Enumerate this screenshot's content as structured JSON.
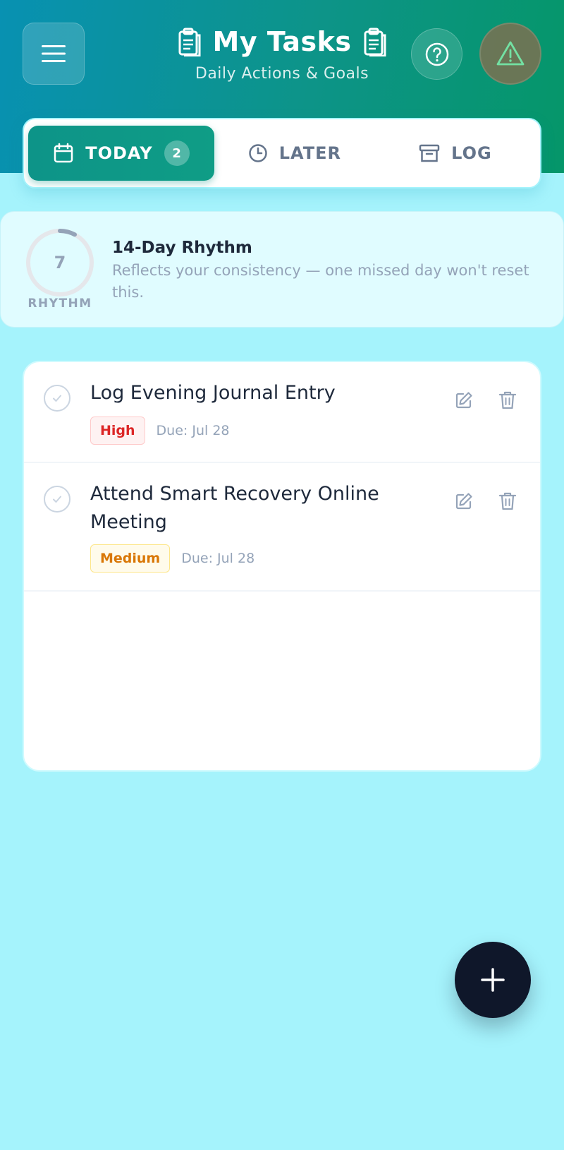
{
  "header": {
    "title": "My Tasks",
    "subtitle": "Daily Actions & Goals",
    "icons": {
      "menu": "hamburger-menu-icon",
      "title_left": "clipboard-icon",
      "title_right": "clipboard-icon",
      "help": "question-circle-icon",
      "alert": "warning-triangle-icon"
    }
  },
  "tabs": [
    {
      "label": "TODAY",
      "icon": "calendar-icon",
      "badge": "2",
      "active": true
    },
    {
      "label": "LATER",
      "icon": "clock-icon",
      "active": false
    },
    {
      "label": "LOG",
      "icon": "archive-icon",
      "active": false
    }
  ],
  "rhythm": {
    "value": "7",
    "ring_label": "RHYTHM",
    "title": "14-Day Rhythm",
    "description": "Reflects your consistency — one missed day won't reset this."
  },
  "tasks": [
    {
      "title": "Log Evening Journal Entry",
      "priority": "High",
      "due": "Due: Jul 28"
    },
    {
      "title": "Attend Smart Recovery Online Meeting",
      "priority": "Medium",
      "due": "Due: Jul 28"
    }
  ],
  "fab": {
    "icon": "plus-icon"
  },
  "colors": {
    "header_start": "#0891b2",
    "header_end": "#059669",
    "active_tab": "#0d9488",
    "page_background": "#a5f3fc",
    "high_priority": "#dc2626",
    "medium_priority": "#d97706",
    "fab": "#0f172a"
  }
}
